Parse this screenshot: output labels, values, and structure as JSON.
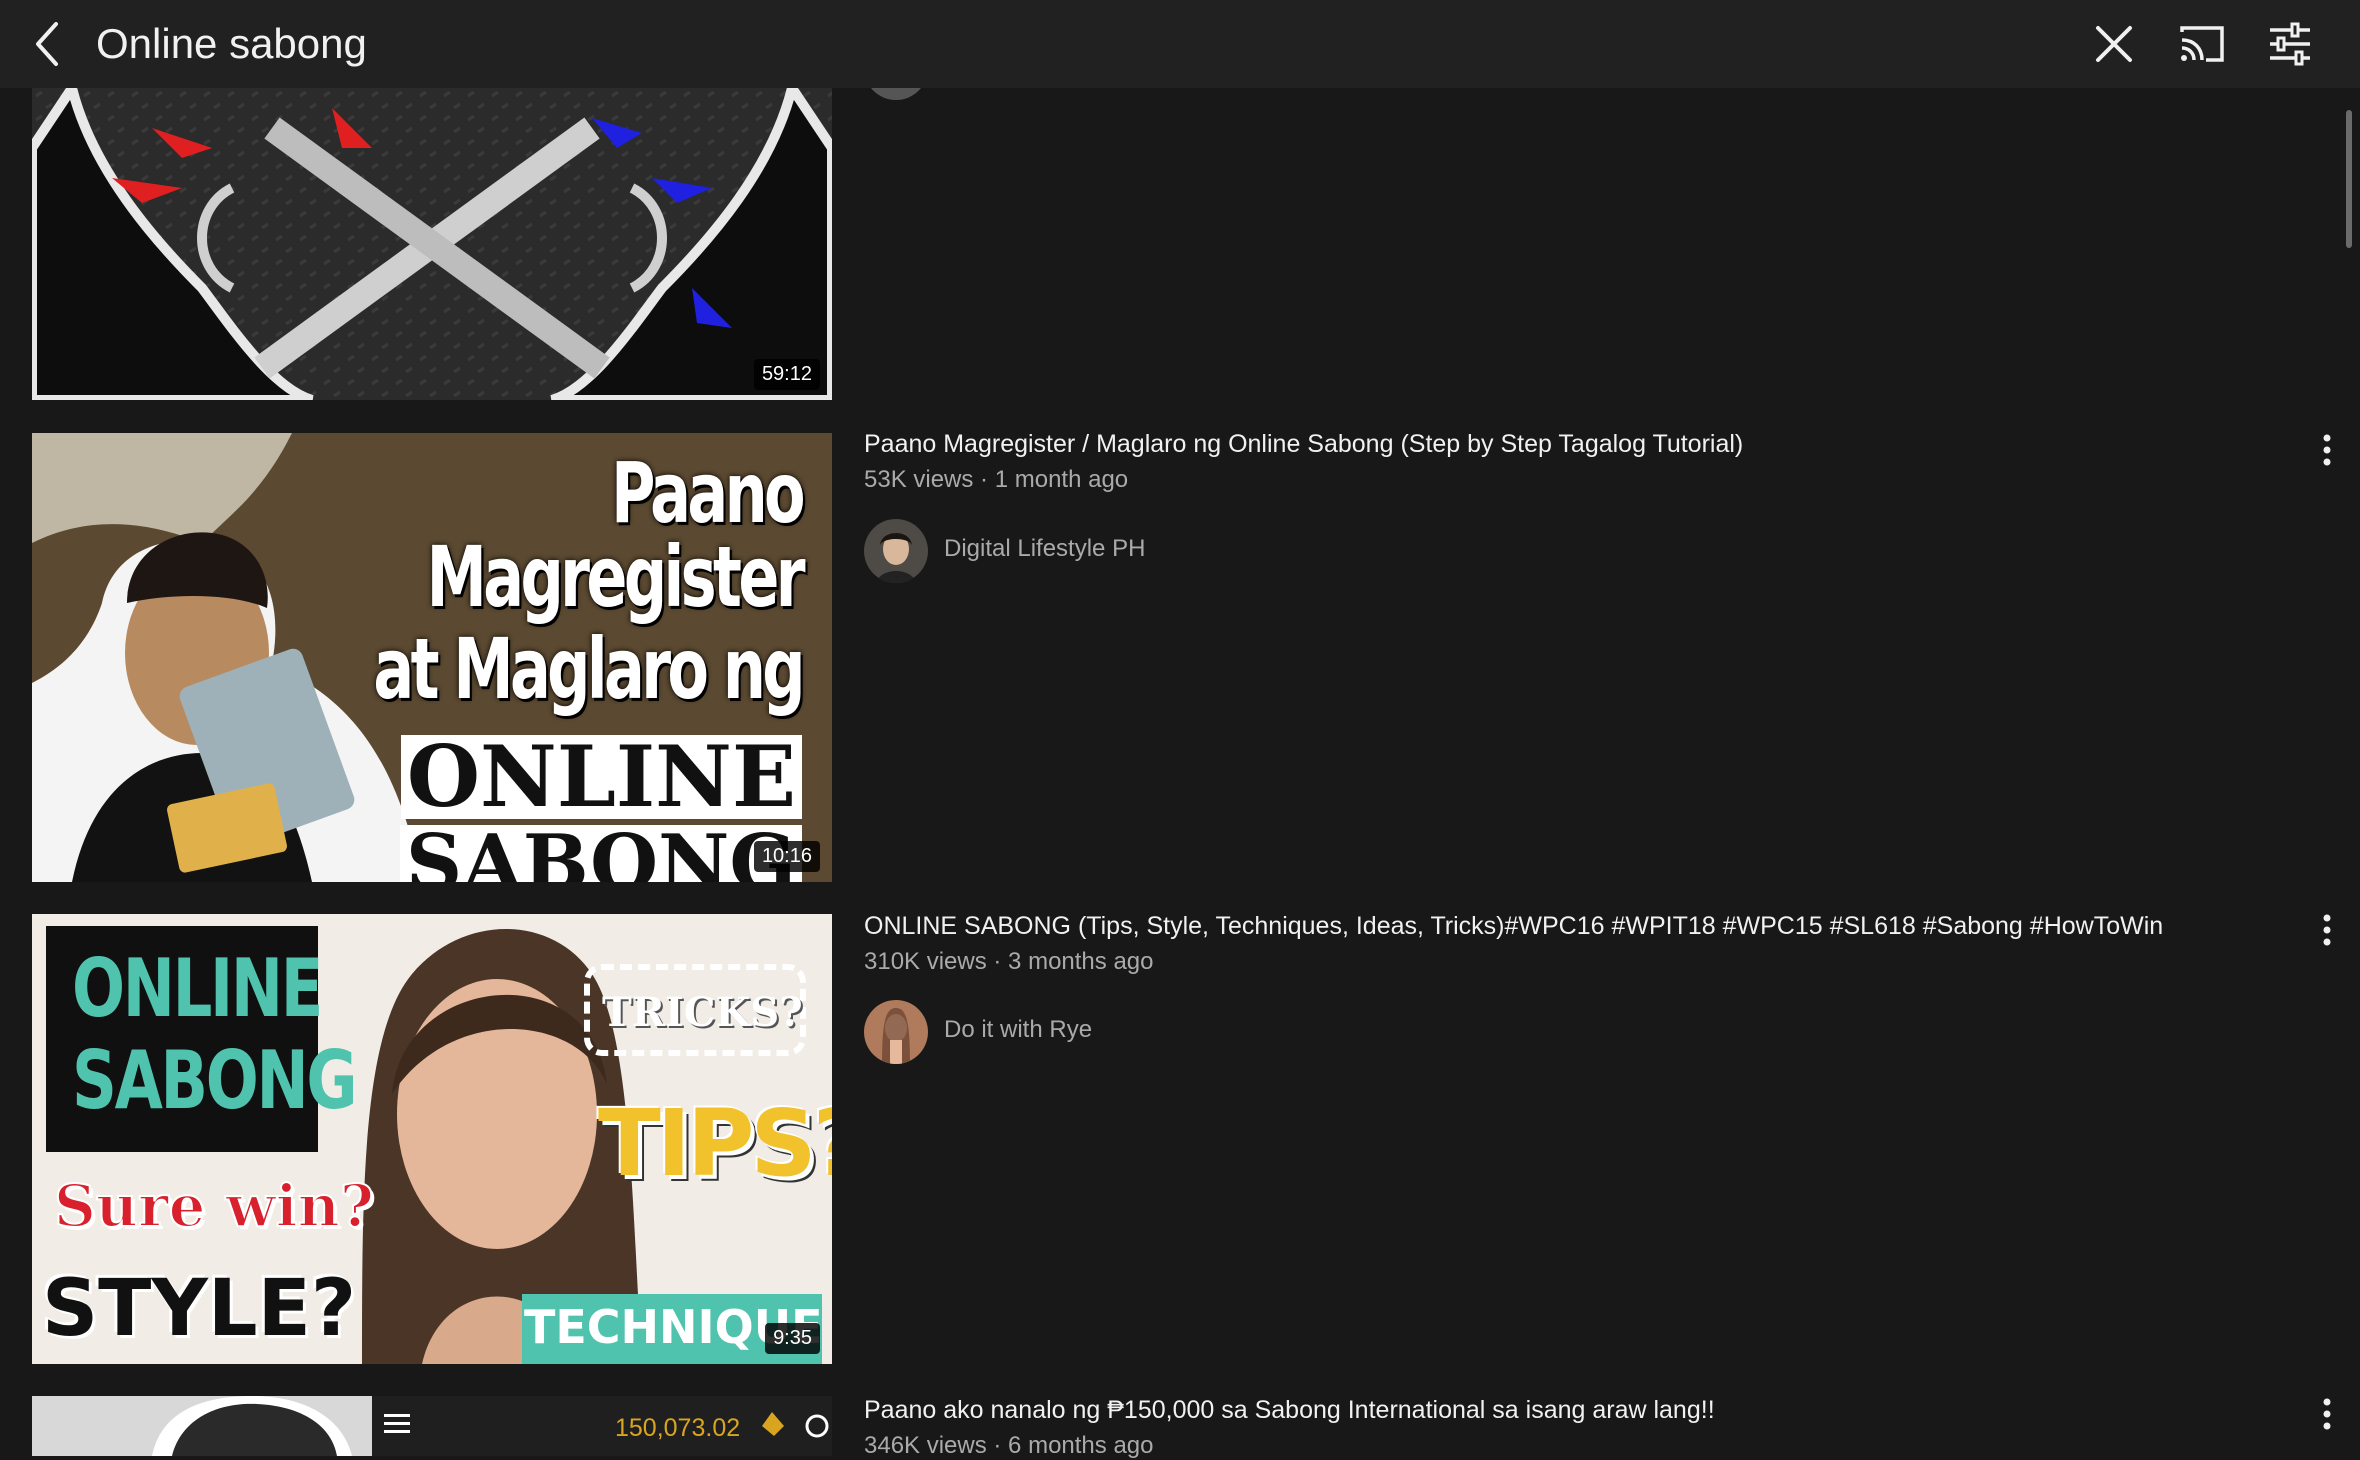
{
  "header": {
    "title": "Online sabong",
    "back_icon": "back-arrow-icon",
    "close_icon": "close-icon",
    "cast_icon": "cast-icon",
    "filter_icon": "filter-sliders-icon"
  },
  "videos": [
    {
      "duration": "59:12"
    },
    {
      "title": "Paano Magregister / Maglaro ng Online Sabong (Step by Step Tagalog Tutorial)",
      "meta": "53K views · 1 month ago",
      "channel": "Digital Lifestyle PH",
      "duration": "10:16",
      "thumb_text": {
        "line1": "Paano Magregister",
        "line2": "at Maglaro ng",
        "line3": "ONLINE",
        "line4": "SABONG"
      }
    },
    {
      "title": "ONLINE SABONG (Tips, Style, Techniques, Ideas, Tricks)#WPC16 #WPIT18 #WPC15 #SL618 #Sabong #HowToWin",
      "meta": "310K views · 3 months ago",
      "channel": "Do it with Rye",
      "duration": "9:35",
      "thumb_text": {
        "box1": "ONLINE",
        "box2": "SABONG",
        "sure": "Sure win?",
        "style": "STYLE?",
        "tricks": "TRICKS?",
        "tips": "TIPS?",
        "tech": "TECHNIQUES"
      }
    },
    {
      "title": "Paano ako nanalo ng ₱150,000 sa Sabong International sa isang araw lang!!",
      "meta": "346K views · 6 months ago",
      "thumb_text": {
        "amount": "150,073.02"
      }
    }
  ],
  "colors": {
    "background": "#181818",
    "header": "#212121",
    "text": "#f1f1f1",
    "secondary": "#aaaaaa"
  }
}
